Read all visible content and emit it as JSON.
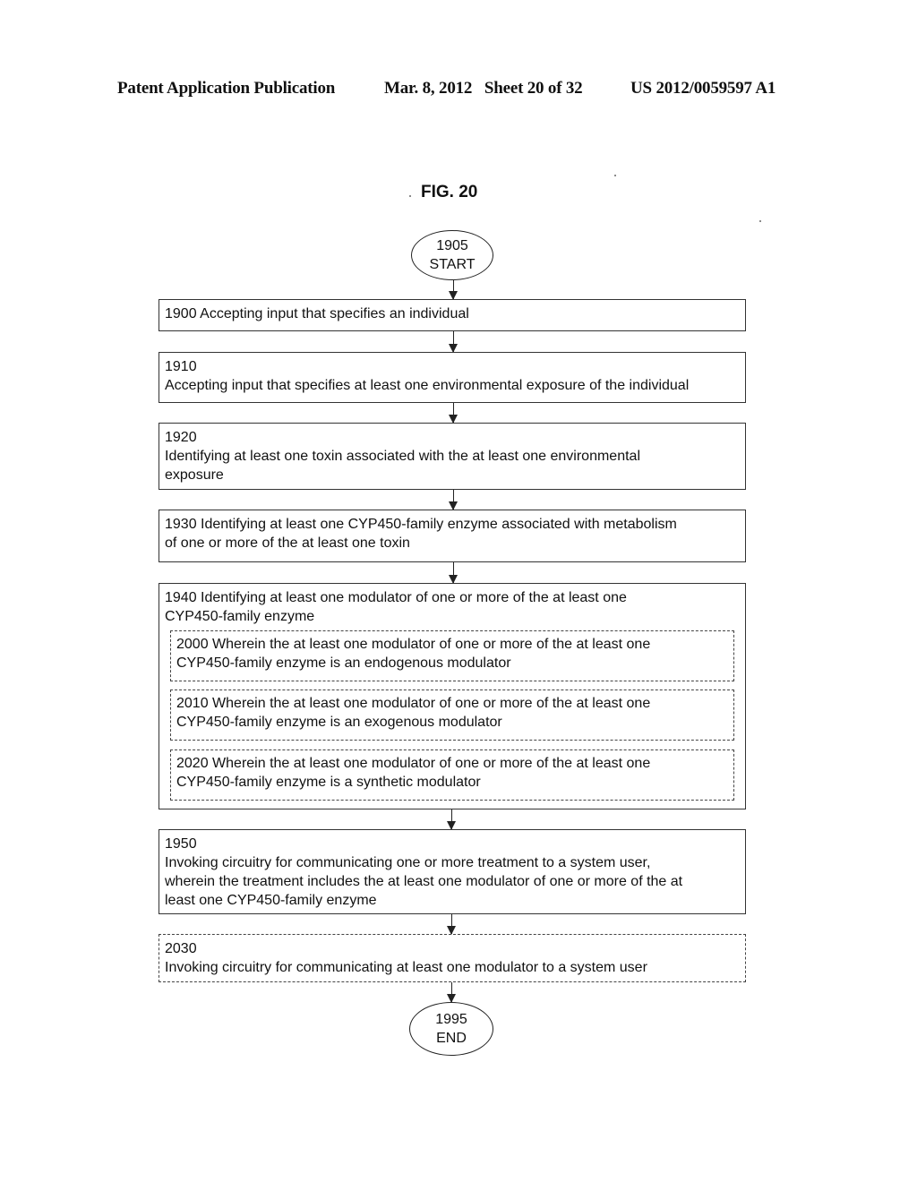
{
  "header": {
    "publication": "Patent Application Publication",
    "date_sheet": "Mar. 8, 2012   Sheet 20 of 32",
    "patent_number": "US 2012/0059597 A1"
  },
  "figure": {
    "title": "FIG. 20"
  },
  "flowchart": {
    "start": {
      "number": "1905",
      "label": "START"
    },
    "steps": [
      {
        "id": "1900",
        "lines": [
          "1900  Accepting input that specifies an individual"
        ],
        "style": "solid"
      },
      {
        "id": "1910",
        "lines": [
          "1910",
          "Accepting input that specifies at least one environmental exposure of the individual"
        ],
        "style": "solid"
      },
      {
        "id": "1920",
        "lines": [
          "1920",
          "Identifying at least one toxin associated with the at least one environmental",
          "exposure"
        ],
        "style": "solid"
      },
      {
        "id": "1930",
        "lines": [
          "1930  Identifying at least one CYP450-family enzyme associated with metabolism",
          "of one or more of the at least one toxin"
        ],
        "style": "solid"
      },
      {
        "id": "1940",
        "lines": [
          "1940  Identifying at least one modulator of one or more of the at least one",
          "CYP450-family enzyme"
        ],
        "style": "solid",
        "substeps": [
          {
            "id": "2000",
            "lines": [
              "2000  Wherein the at least one modulator of one or more of the at least one",
              "CYP450-family enzyme is an endogenous modulator"
            ],
            "style": "dashed"
          },
          {
            "id": "2010",
            "lines": [
              "2010  Wherein the at least one modulator of one or more of the at least one",
              "CYP450-family enzyme is an exogenous modulator"
            ],
            "style": "dashed"
          },
          {
            "id": "2020",
            "lines": [
              "2020  Wherein the at least one modulator of one or more of the at least one",
              "CYP450-family enzyme is a synthetic modulator"
            ],
            "style": "dashed"
          }
        ]
      },
      {
        "id": "1950",
        "lines": [
          "1950",
          "Invoking circuitry for communicating one or more treatment to a system user,",
          "wherein the treatment includes the at least one modulator of one or more of the at",
          "least one CYP450-family enzyme"
        ],
        "style": "solid"
      },
      {
        "id": "2030",
        "lines": [
          "2030",
          "Invoking circuitry for communicating at least one modulator to a system user"
        ],
        "style": "dashed"
      }
    ],
    "end": {
      "number": "1995",
      "label": "END"
    }
  }
}
